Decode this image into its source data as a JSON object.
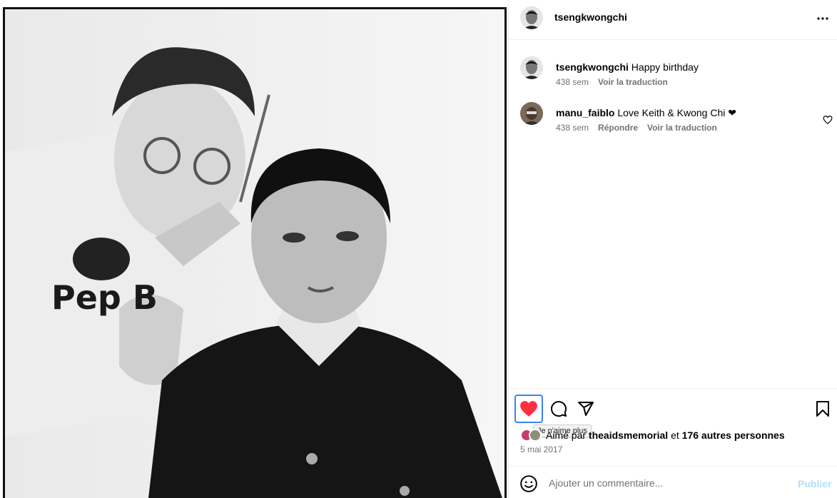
{
  "post": {
    "author": "tsengkwongchi"
  },
  "comments": [
    {
      "user": "tsengkwongchi",
      "text": "Happy birthday",
      "age": "438 sem",
      "translate": "Voir la traduction"
    },
    {
      "user": "manu_faiblo",
      "text": "Love Keith & Kwong Chi ❤",
      "age": "438 sem",
      "reply": "Répondre",
      "translate": "Voir la traduction"
    }
  ],
  "actions": {
    "like_tooltip": "Je n'aime plus"
  },
  "likes": {
    "prefix": "Aimé par",
    "user": "theaidsmemorial",
    "conj": "et",
    "others": "176 autres personnes"
  },
  "date": "5 mai 2017",
  "composer": {
    "placeholder": "Ajouter un commentaire...",
    "publish": "Publier"
  },
  "colors": {
    "like_red": "#ff3040",
    "publish_disabled": "#b2dffc",
    "muted": "#737373"
  }
}
